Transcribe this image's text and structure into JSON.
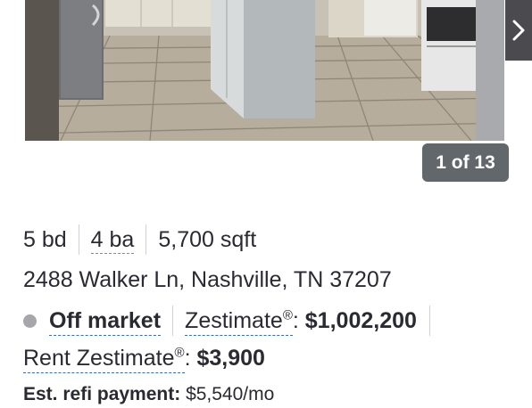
{
  "gallery": {
    "counter_text": "1 of 13",
    "next_icon": "chevron-right-icon"
  },
  "facts": {
    "beds": "5 bd",
    "baths": "4 ba",
    "sqft": "5,700 sqft"
  },
  "address": "2488 Walker Ln, Nashville, TN 37207",
  "status": {
    "label": "Off market",
    "dot_color": "#a7a6ab"
  },
  "zestimate": {
    "label": "Zestimate",
    "reg": "®",
    "colon": ":",
    "value": "$1,002,200"
  },
  "rent_zestimate": {
    "label": "Rent Zestimate",
    "reg": "®",
    "colon": ":",
    "value": "$3,900"
  },
  "refi": {
    "label": "Est. refi payment:",
    "value": "$5,540/mo"
  },
  "colors": {
    "link_underline": "#1277e1",
    "text": "#2a2a33",
    "counter_bg": "#62676b"
  }
}
